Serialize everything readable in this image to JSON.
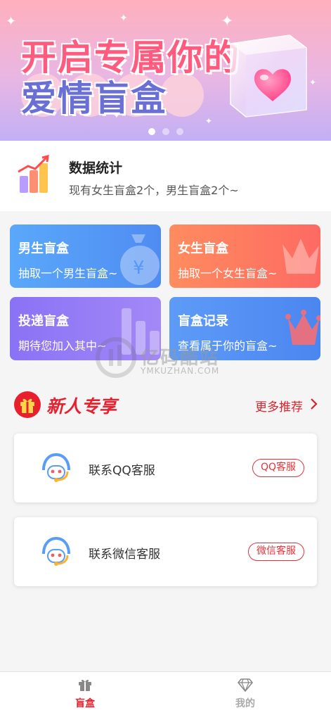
{
  "banner": {
    "line1": "开启专属你的",
    "line2": "爱情盲盒",
    "slides": 3,
    "active_slide": 1
  },
  "stats": {
    "title": "数据统计",
    "subtitle": "现有女生盲盒2个，男生盲盒2个~"
  },
  "cards": [
    {
      "title": "男生盲盒",
      "subtitle": "抽取一个男生盲盒~",
      "color": "#5aa8fa"
    },
    {
      "title": "女生盲盒",
      "subtitle": "抽取一个女生盲盒~",
      "color": "#fd6a62"
    },
    {
      "title": "投递盲盒",
      "subtitle": "期待您加入其中~",
      "color": "#8a72f5"
    },
    {
      "title": "盲盒记录",
      "subtitle": "查看属于你的盲盒~",
      "color": "#4b86f0"
    }
  ],
  "watermark": {
    "text": "亿码酷站",
    "sub": "YMKUZHAN.COM"
  },
  "new_user": {
    "title": "新人专享",
    "more": "更多推荐"
  },
  "services": [
    {
      "label": "联系QQ客服",
      "button": "QQ客服"
    },
    {
      "label": "联系微信客服",
      "button": "微信客服"
    }
  ],
  "nav": {
    "items": [
      {
        "label": "盲盒",
        "icon": "gift-icon",
        "active": true
      },
      {
        "label": "我的",
        "icon": "diamond-icon",
        "active": false
      }
    ],
    "active_color": "#e8202e"
  }
}
